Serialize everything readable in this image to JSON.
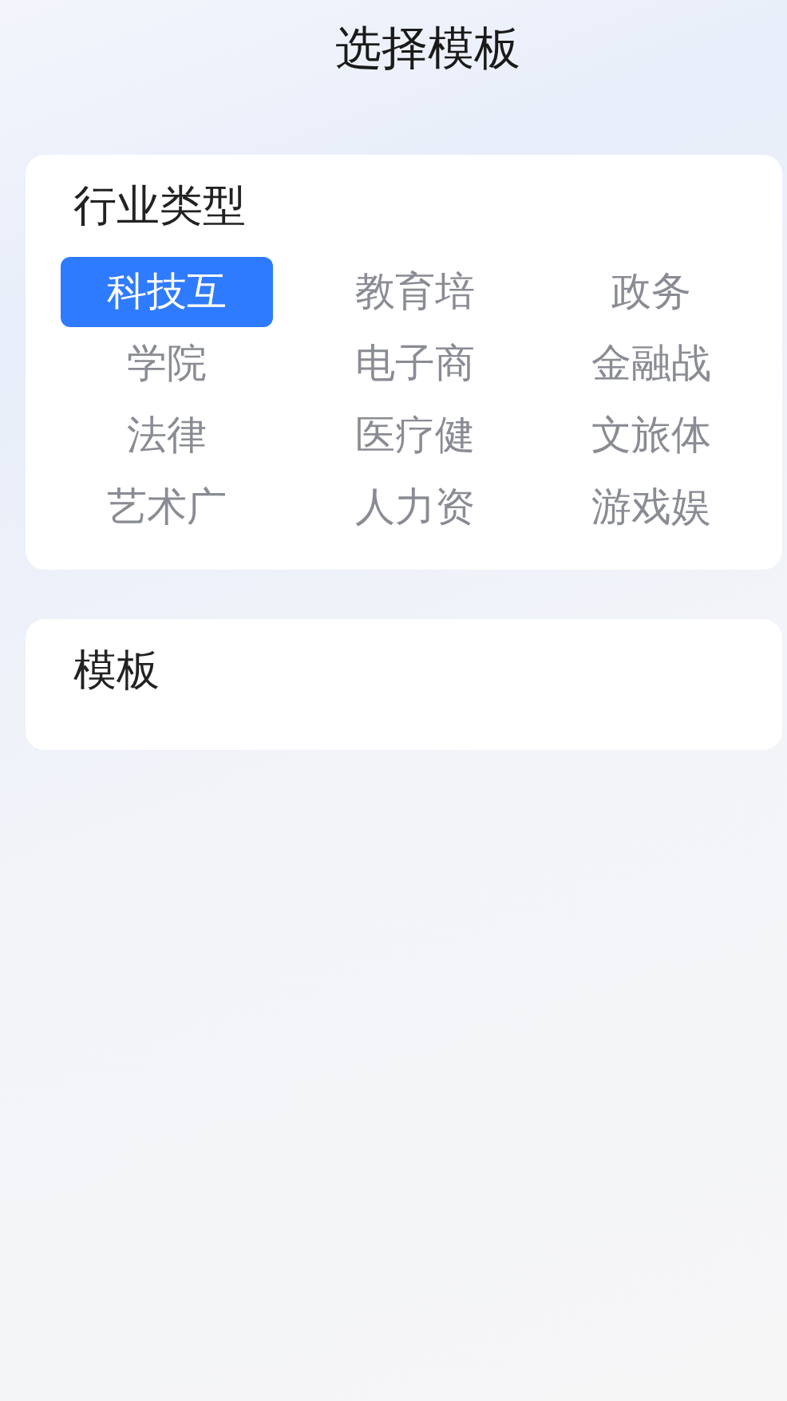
{
  "header": {
    "title": "选择模板"
  },
  "industry": {
    "title": "行业类型",
    "items": [
      {
        "label": "科技互",
        "selected": true
      },
      {
        "label": "教育培",
        "selected": false
      },
      {
        "label": "政务",
        "selected": false
      },
      {
        "label": "学院",
        "selected": false
      },
      {
        "label": "电子商",
        "selected": false
      },
      {
        "label": "金融战",
        "selected": false
      },
      {
        "label": "法律",
        "selected": false
      },
      {
        "label": "医疗健",
        "selected": false
      },
      {
        "label": "文旅体",
        "selected": false
      },
      {
        "label": "艺术广",
        "selected": false
      },
      {
        "label": "人力资",
        "selected": false
      },
      {
        "label": "游戏娱",
        "selected": false
      }
    ]
  },
  "templates": {
    "title": "模板"
  }
}
